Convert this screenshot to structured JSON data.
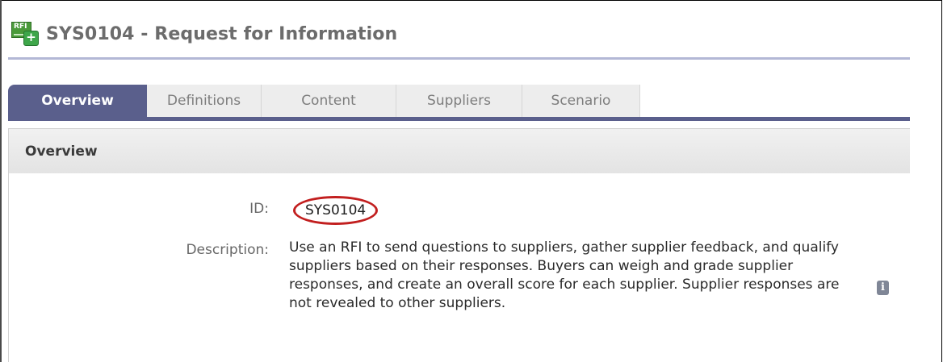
{
  "header": {
    "icon_text": "RFI",
    "icon_plus": "+",
    "title": "SYS0104 - Request for Information"
  },
  "tabs": [
    {
      "label": "Overview",
      "active": true
    },
    {
      "label": "Definitions",
      "active": false
    },
    {
      "label": "Content",
      "active": false
    },
    {
      "label": "Suppliers",
      "active": false
    },
    {
      "label": "Scenario",
      "active": false
    }
  ],
  "section": {
    "title": "Overview",
    "id_label": "ID:",
    "id_value": "SYS0104",
    "description_label": "Description:",
    "description_value": "Use an RFI to send questions to suppliers, gather supplier feedback, and qualify suppliers based on their responses. Buyers can weigh and grade supplier responses, and create an overall score for each supplier. Supplier responses are not revealed to other suppliers.",
    "info_glyph": "i"
  },
  "colors": {
    "tab_active": "#5a5f8c",
    "title_rule": "#b3b8d6",
    "id_highlight": "#c21f1f"
  }
}
